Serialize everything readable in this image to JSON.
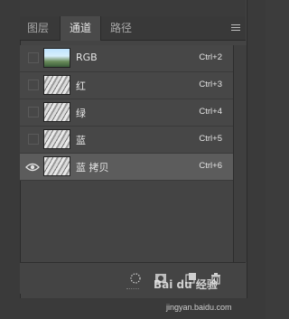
{
  "tabs": [
    {
      "label": "图层",
      "active": false
    },
    {
      "label": "通道",
      "active": true
    },
    {
      "label": "路径",
      "active": false
    }
  ],
  "channels": [
    {
      "name": "RGB",
      "shortcut": "Ctrl+2",
      "visible": false,
      "selected": false,
      "thumb": "rgb"
    },
    {
      "name": "红",
      "shortcut": "Ctrl+3",
      "visible": false,
      "selected": false,
      "thumb": "gray"
    },
    {
      "name": "绿",
      "shortcut": "Ctrl+4",
      "visible": false,
      "selected": false,
      "thumb": "gray"
    },
    {
      "name": "蓝",
      "shortcut": "Ctrl+5",
      "visible": false,
      "selected": false,
      "thumb": "gray"
    },
    {
      "name": "蓝 拷贝",
      "shortcut": "Ctrl+6",
      "visible": true,
      "selected": true,
      "thumb": "gray"
    }
  ],
  "bottom_icons": [
    "dotted-circle-selection-icon",
    "mask-icon",
    "new-channel-icon",
    "trash-icon"
  ],
  "watermark": {
    "brand": "Bai du 经验",
    "url": "jingyan.baidu.com"
  },
  "colors": {
    "panel": "#444444",
    "selected_row": "#5c5c5c",
    "text": "#e5e5e5"
  }
}
